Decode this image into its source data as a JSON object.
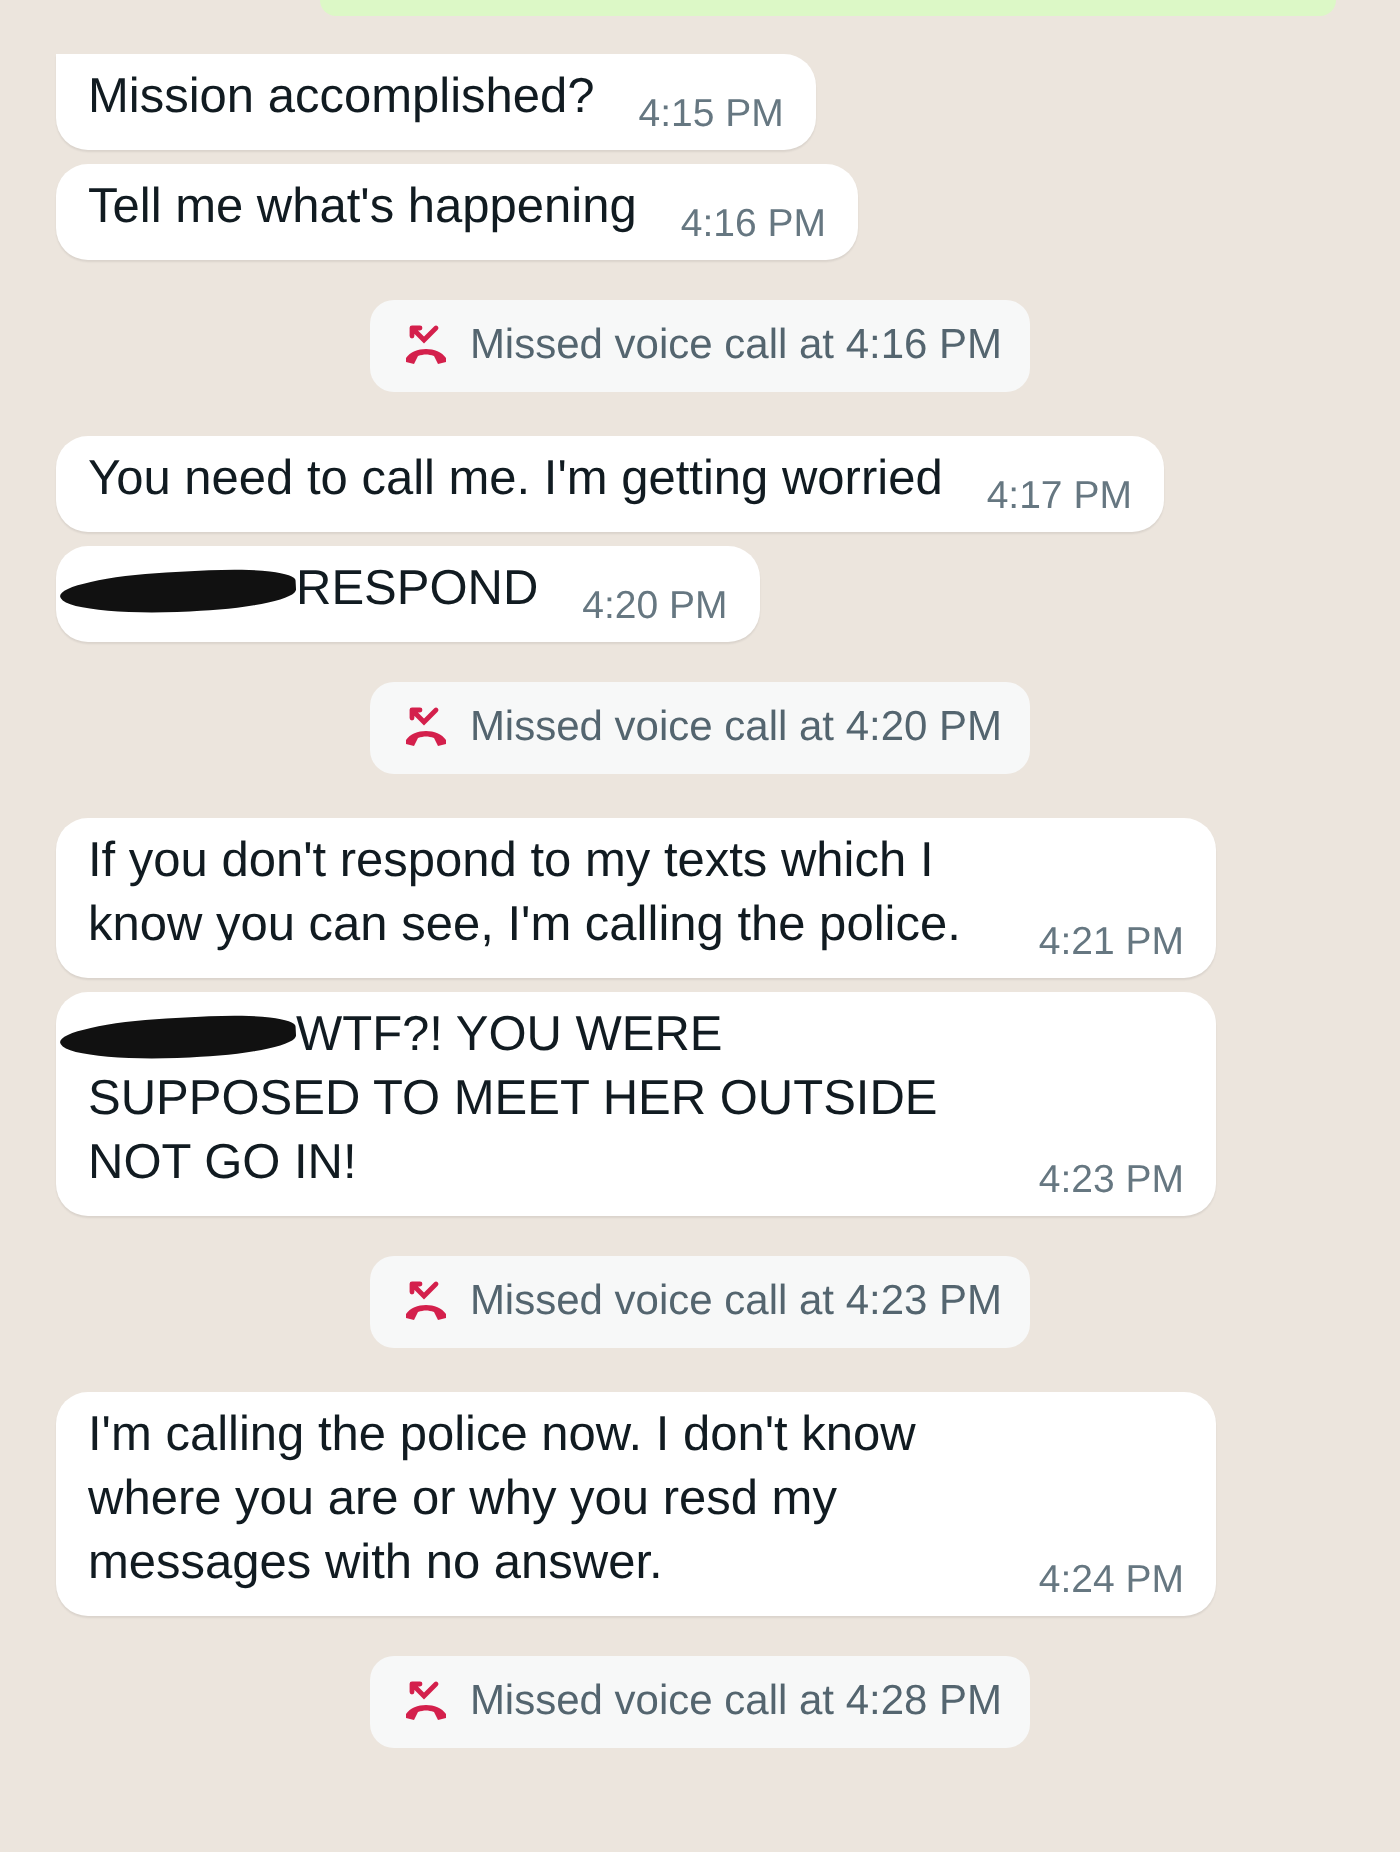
{
  "chat": {
    "items": [
      {
        "kind": "sent_partial"
      },
      {
        "kind": "message",
        "text": "Mission accomplished?",
        "time": "4:15 PM",
        "tail": true,
        "redacted": false
      },
      {
        "kind": "message",
        "text": "Tell me what's happening",
        "time": "4:16 PM",
        "tail": false,
        "redacted": false
      },
      {
        "kind": "call",
        "text": "Missed voice call at 4:16 PM"
      },
      {
        "kind": "message",
        "text": "You need to call me. I'm getting worried",
        "time": "4:17 PM",
        "tail": false,
        "redacted": false
      },
      {
        "kind": "message",
        "text": "RESPOND",
        "time": "4:20 PM",
        "tail": false,
        "redacted": true
      },
      {
        "kind": "call",
        "text": "Missed voice call at 4:20 PM"
      },
      {
        "kind": "message",
        "text": "If you don't respond to my texts which I know you can see, I'm calling the police.",
        "time": "4:21 PM",
        "tail": false,
        "redacted": false
      },
      {
        "kind": "message",
        "text": "WTF?! YOU WERE SUPPOSED TO MEET HER OUTSIDE NOT GO IN!",
        "time": "4:23 PM",
        "tail": false,
        "redacted": true
      },
      {
        "kind": "call",
        "text": "Missed voice call at 4:23 PM"
      },
      {
        "kind": "message",
        "text": "I'm calling the police now. I don't know where you are or why you resd my messages with no answer.",
        "time": "4:24 PM",
        "tail": false,
        "redacted": false
      },
      {
        "kind": "call",
        "text": "Missed voice call at 4:28 PM"
      }
    ]
  }
}
